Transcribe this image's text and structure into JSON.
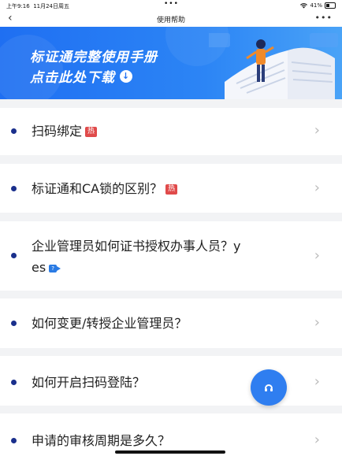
{
  "status": {
    "time": "上午9:16",
    "date": "11月24日周五",
    "dots": "•••",
    "wifi": "wifi-icon",
    "battery_pct": "41%"
  },
  "nav": {
    "back": "‹",
    "title": "使用帮助",
    "more": "•••"
  },
  "banner": {
    "line1": "标证通完整使用手册",
    "line2": "点击此处下载"
  },
  "items": [
    {
      "text": "扫码绑定",
      "badge": "热"
    },
    {
      "text": "标证通和CA锁的区别？",
      "badge": "热"
    },
    {
      "text_line1": "企业管理员如何证书授权办事人员？y",
      "text_line2": "es",
      "badge": "?"
    },
    {
      "text": "如何变更/转授企业管理员？"
    },
    {
      "text": "如何开启扫码登陆？"
    },
    {
      "text": "申请的审核周期是多久？"
    }
  ],
  "chevron": "›",
  "colors": {
    "accent": "#2f7ef0",
    "hot": "#e04a4a",
    "bullet": "#1a2f8c"
  }
}
